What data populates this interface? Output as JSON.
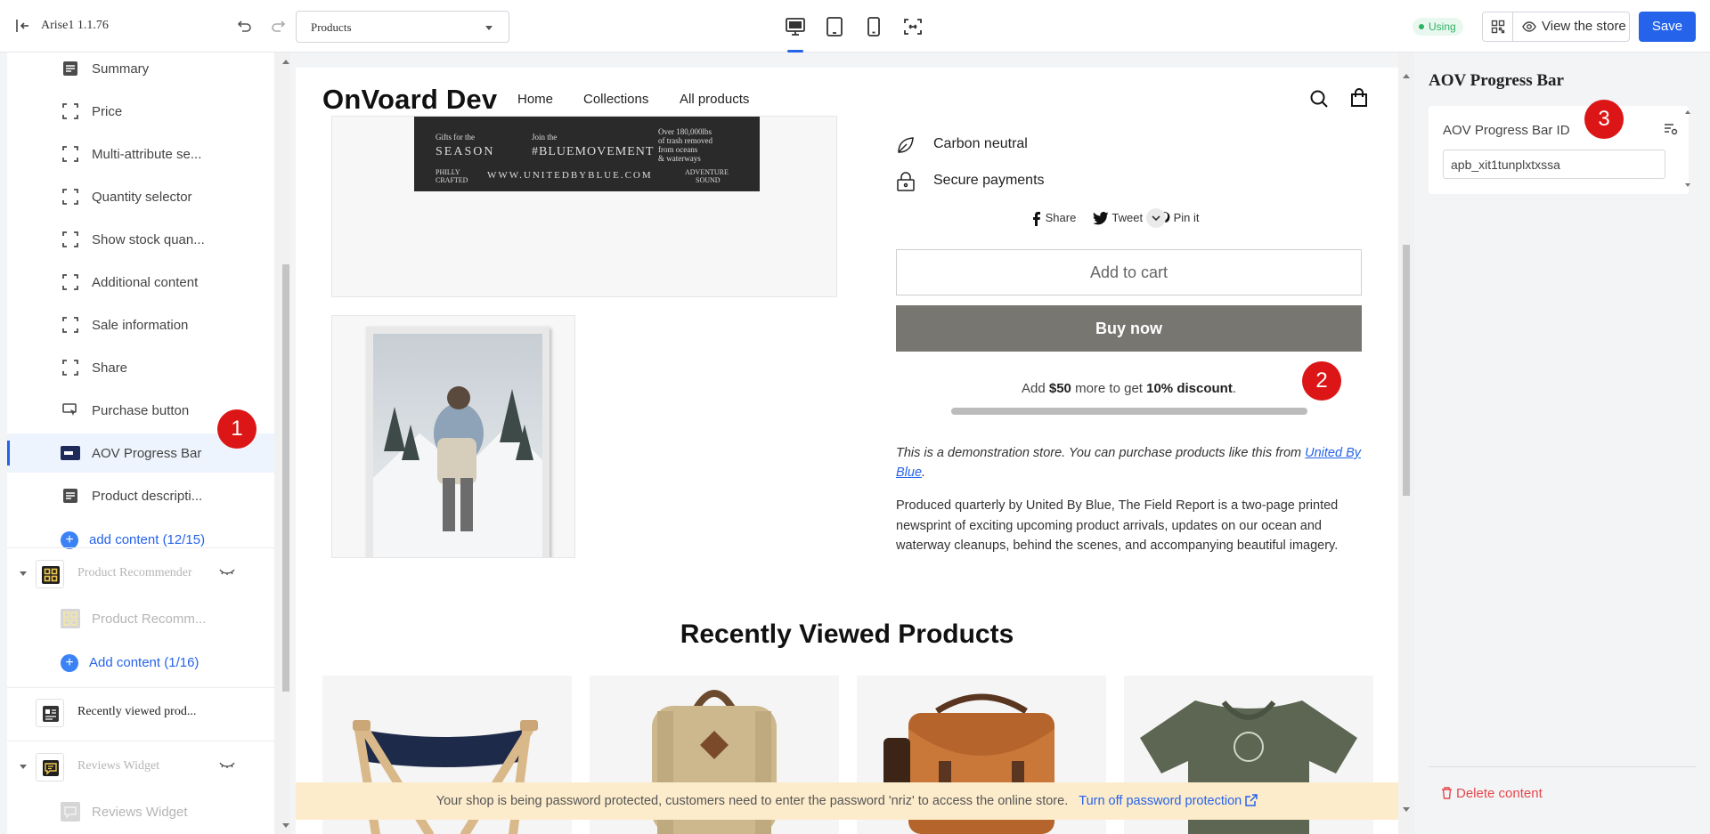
{
  "topbar": {
    "app_version": "Arise1 1.1.76",
    "page_select": "Products",
    "using_badge": "Using",
    "view_store": "View the store",
    "save": "Save"
  },
  "sidebar": {
    "items": [
      {
        "label": "Summary"
      },
      {
        "label": "Price"
      },
      {
        "label": "Multi-attribute se..."
      },
      {
        "label": "Quantity selector"
      },
      {
        "label": "Show stock quan..."
      },
      {
        "label": "Additional content"
      },
      {
        "label": "Sale information"
      },
      {
        "label": "Share"
      },
      {
        "label": "Purchase button"
      },
      {
        "label": "AOV Progress Bar"
      },
      {
        "label": "Product descripti..."
      }
    ],
    "add_content_1": "add content (12/15)",
    "sections": {
      "product_recommender": "Product Recommender",
      "product_recomm_child": "Product Recomm...",
      "add_content_2": "Add content (1/16)",
      "recently_viewed": "Recently viewed prod...",
      "reviews_widget": "Reviews Widget",
      "reviews_widget_child": "Reviews Widget"
    }
  },
  "store": {
    "logo": "OnVoard Dev",
    "nav": [
      "Home",
      "Collections",
      "All products"
    ],
    "poster": {
      "gifts": "Gifts for the",
      "season": "SEASON",
      "join": "Join the",
      "movement": "#BLUEMOVEMENT",
      "over": "Over 180,000lbs",
      "trash": "of trash removed",
      "oceans": "from oceans",
      "waterways": "& waterways",
      "philly": "PHILLY",
      "crafted": "CRAFTED",
      "url": "WWW.UNITEDBYBLUE.COM",
      "adventure": "ADVENTURE",
      "sound": "SOUND"
    },
    "features": [
      "Carbon neutral",
      "Secure payments"
    ],
    "share": {
      "share": "Share",
      "tweet": "Tweet",
      "pin": "Pin it"
    },
    "add_to_cart": "Add to cart",
    "buy_now": "Buy now",
    "aov": {
      "prefix": "Add",
      "amount": "$50",
      "middle": "more to get",
      "discount": "10% discount",
      "suffix": ".",
      "progress": 1.0
    },
    "demo_text": "This is a demonstration store. You can purchase products like this from",
    "demo_link": "United By Blue",
    "demo_end": ".",
    "description": "Produced quarterly by United By Blue, The Field Report is a two-page printed newsprint of exciting upcoming product arrivals, updates on our ocean and waterway cleanups, behind the scenes, and accompanying beautiful imagery.",
    "recently_viewed_title": "Recently Viewed Products"
  },
  "banner": {
    "text": "Your shop is being password protected, customers need to enter the password 'nriz' to access the online store.",
    "link": "Turn off password protection"
  },
  "panel": {
    "title": "AOV Progress Bar",
    "field_label": "AOV Progress Bar ID",
    "field_value": "apb_xit1tunplxtxssa",
    "delete": "Delete content"
  },
  "markers": [
    "1",
    "2",
    "3"
  ],
  "colors": {
    "accent": "#2563eb",
    "marker": "#dc1616",
    "buy_now": "#777671",
    "banner": "#fdeccb"
  }
}
